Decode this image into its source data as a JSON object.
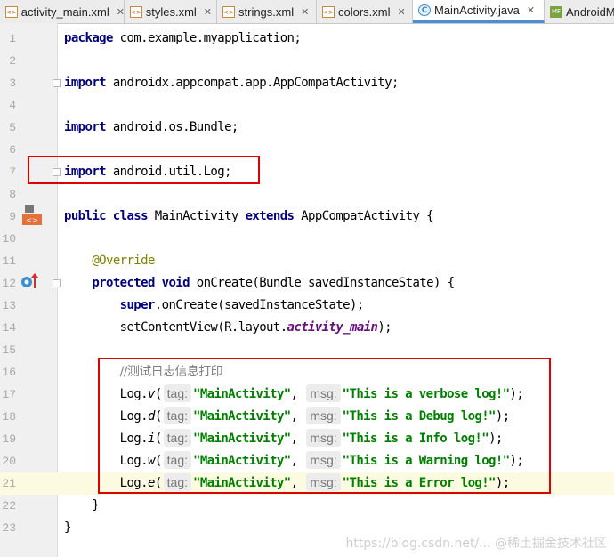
{
  "tabs": [
    {
      "label": "activity_main.xml",
      "icon": "xml-file-icon",
      "active": false
    },
    {
      "label": "styles.xml",
      "icon": "xml-file-icon",
      "active": false
    },
    {
      "label": "strings.xml",
      "icon": "xml-file-icon",
      "active": false
    },
    {
      "label": "colors.xml",
      "icon": "xml-file-icon",
      "active": false
    },
    {
      "label": "MainActivity.java",
      "icon": "java-class-icon",
      "active": true
    },
    {
      "label": "AndroidM",
      "icon": "manifest-file-icon",
      "active": false
    }
  ],
  "line_numbers": [
    "1",
    "2",
    "3",
    "4",
    "5",
    "6",
    "7",
    "8",
    "9",
    "10",
    "11",
    "12",
    "13",
    "14",
    "15",
    "16",
    "17",
    "18",
    "19",
    "20",
    "21",
    "22",
    "23"
  ],
  "code": {
    "l1": {
      "kw": "package",
      "rest": " com.example.myapplication;"
    },
    "l3": {
      "kw": "import",
      "rest": " androidx.appcompat.app.AppCompatActivity;"
    },
    "l5": {
      "kw": "import",
      "rest": " android.os.Bundle;"
    },
    "l7": {
      "kw": "import",
      "rest": " android.util.Log;"
    },
    "l9": {
      "kw1": "public class",
      "mid": " MainActivity ",
      "kw2": "extends",
      "rest": " AppCompatActivity {"
    },
    "l11": {
      "ann": "@Override"
    },
    "l12": {
      "kw": "protected void",
      "rest": " onCreate(Bundle savedInstanceState) {"
    },
    "l13": {
      "kw": "super",
      "rest": ".onCreate(savedInstanceState);"
    },
    "l14": {
      "pre": "setContentView(R.layout.",
      "field": "activity_main",
      "post": ");"
    },
    "l16": {
      "comment": "//测试日志信息打印"
    },
    "l22": {
      "text": "}"
    },
    "l23": {
      "text": "}"
    },
    "log_calls": [
      {
        "method": "v",
        "tag": "\"MainActivity\"",
        "msg": "\"This is a verbose log!\""
      },
      {
        "method": "d",
        "tag": "\"MainActivity\"",
        "msg": "\"This is a Debug log!\""
      },
      {
        "method": "i",
        "tag": "\"MainActivity\"",
        "msg": "\"This is a Info log!\""
      },
      {
        "method": "w",
        "tag": "\"MainActivity\"",
        "msg": "\"This is a Warning log!\""
      },
      {
        "method": "e",
        "tag": "\"MainActivity\"",
        "msg": "\"This is a Error log!\""
      }
    ],
    "hint_tag": "tag:",
    "hint_msg": "msg:",
    "log_prefix": "Log.",
    "open_paren": "(",
    "comma": ",",
    "close": ");"
  },
  "watermark": "https://blog.csdn.net/...  @稀土掘金技术社区",
  "colors": {
    "keyword": "#000080",
    "string": "#008000",
    "annotation": "#808000",
    "highlight_box": "#e00000",
    "current_line": "#fcfae1"
  }
}
